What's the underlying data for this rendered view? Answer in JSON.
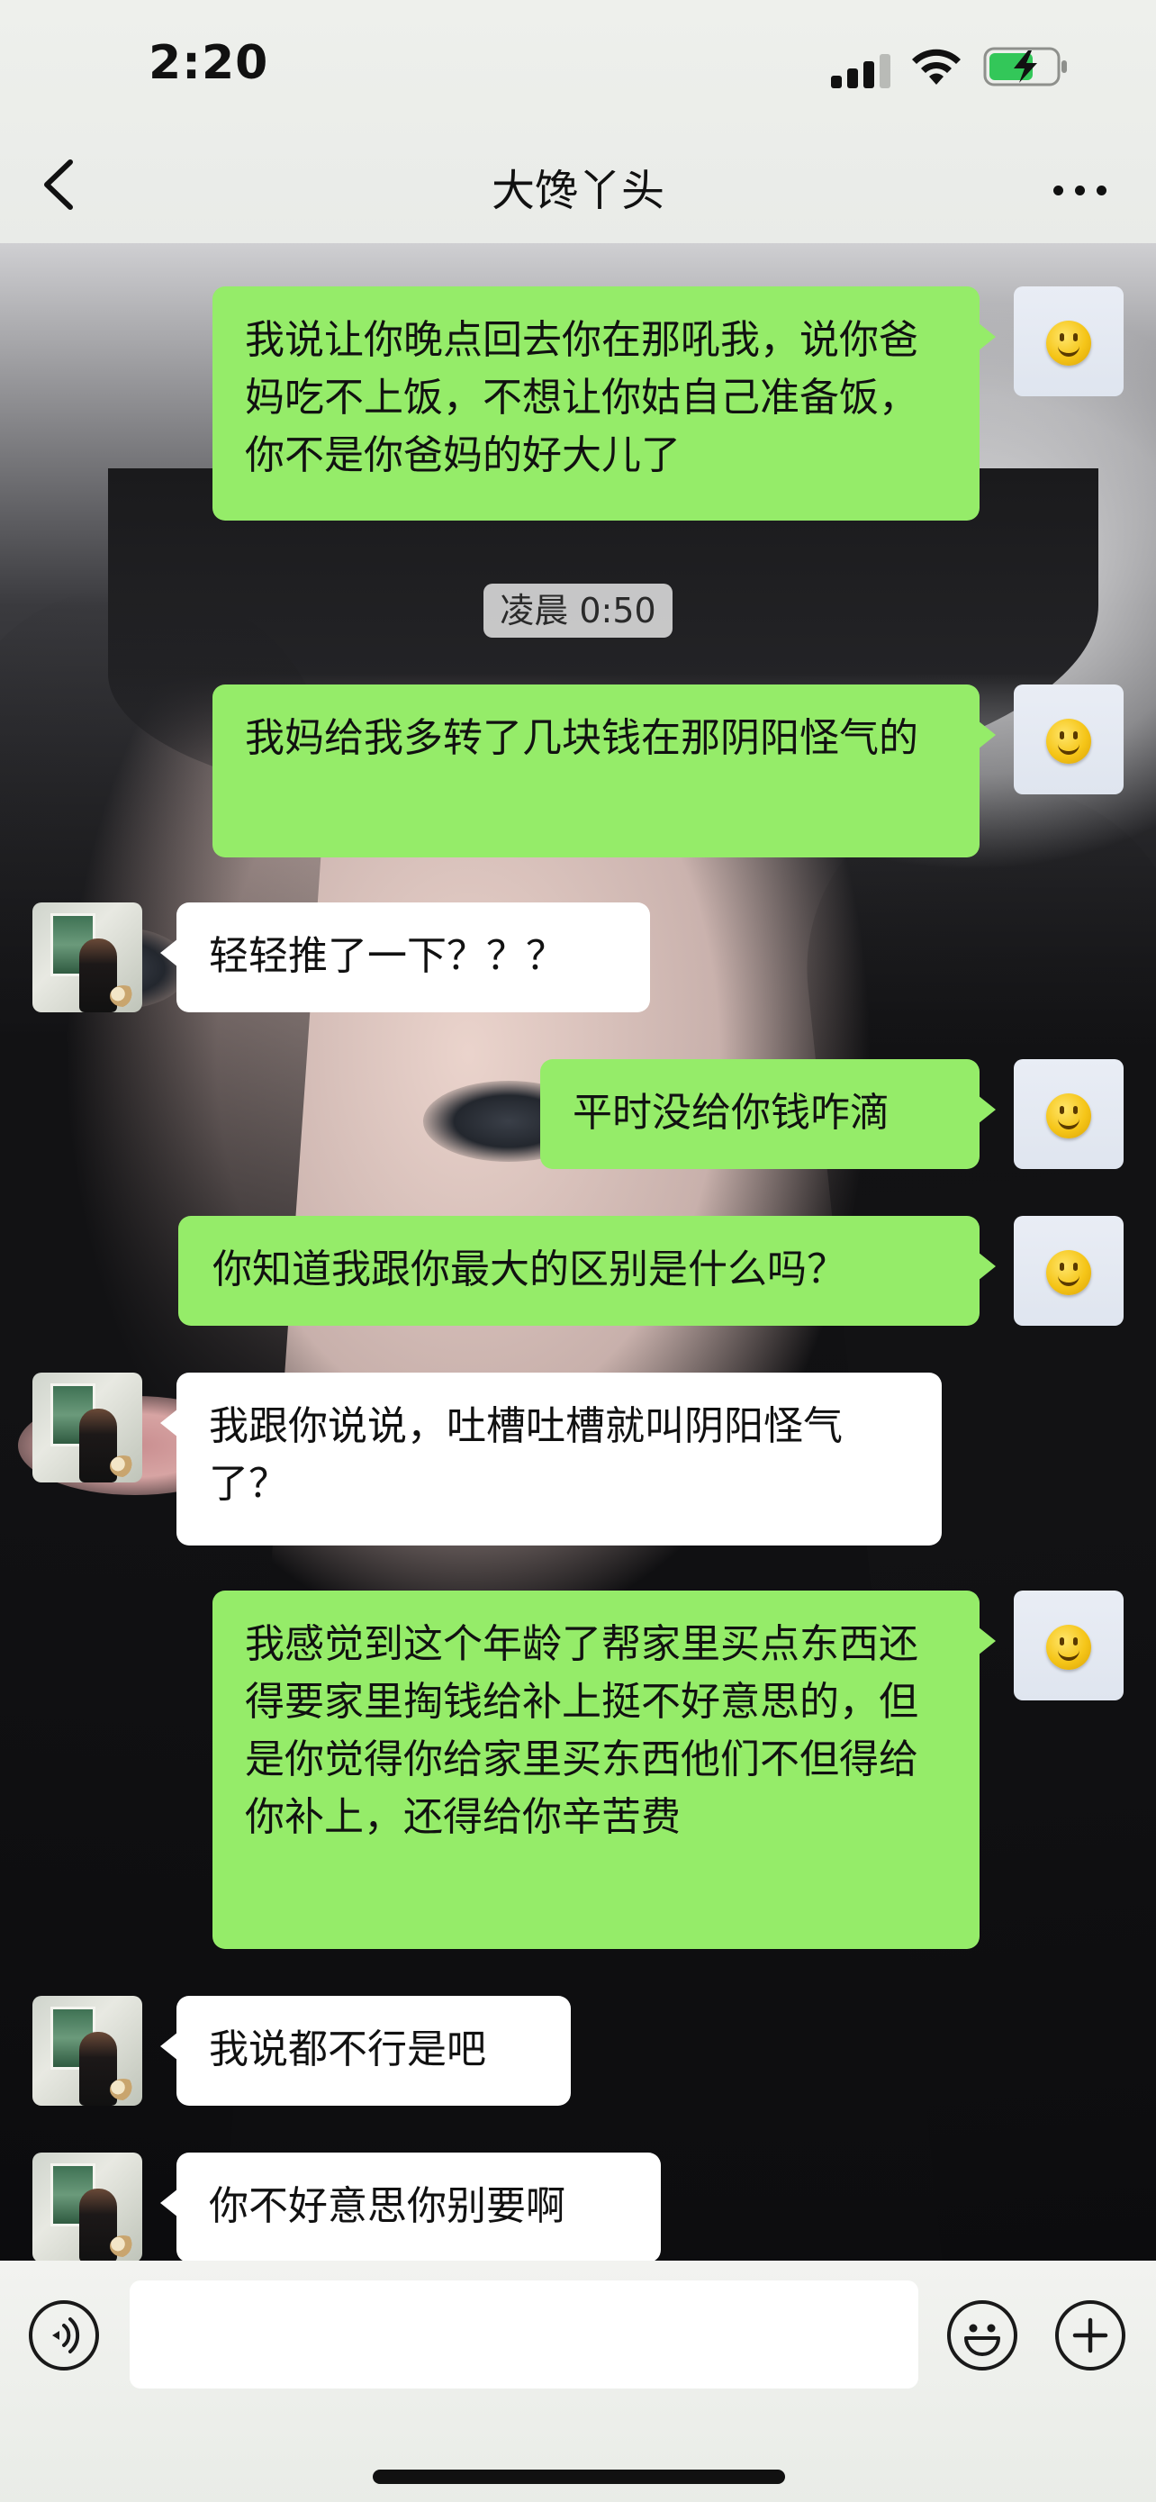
{
  "status_bar": {
    "time": "2:20",
    "icons": [
      "signal-icon",
      "wifi-icon",
      "battery-charging-icon"
    ]
  },
  "nav": {
    "title": "大馋丫头",
    "back_icon": "chevron-left-icon",
    "more_icon": "more-dots-icon"
  },
  "chat": {
    "timestamp": "凌晨 0:50",
    "messages": [
      {
        "from": "self",
        "text": "我说让你晚点回去你在那吼我，说你爸妈吃不上饭，不想让你姑自己准备饭，你不是你爸妈的好大儿了"
      },
      {
        "from": "self",
        "text": "我妈给我多转了几块钱在那阴阳怪气的"
      },
      {
        "from": "friend",
        "text": "轻轻推了一下？？？"
      },
      {
        "from": "self",
        "text": "平时没给你钱咋滴"
      },
      {
        "from": "self",
        "text": "你知道我跟你最大的区别是什么吗？"
      },
      {
        "from": "friend",
        "text": "我跟你说说，吐槽吐槽就叫阴阳怪气了？"
      },
      {
        "from": "self",
        "text": "我感觉到这个年龄了帮家里买点东西还得要家里掏钱给补上挺不好意思的，但是你觉得你给家里买东西他们不但得给你补上，还得给你辛苦费"
      },
      {
        "from": "friend",
        "text": "我说都不行是吧"
      },
      {
        "from": "friend",
        "text": "你不好意思你别要啊"
      }
    ]
  },
  "input_bar": {
    "voice_icon": "voice-icon",
    "emoji_icon": "emoji-icon",
    "plus_icon": "plus-icon",
    "input_value": ""
  },
  "colors": {
    "self_bubble": "#95ec69",
    "friend_bubble": "#ffffff",
    "top_bar": "#eef0ec"
  }
}
